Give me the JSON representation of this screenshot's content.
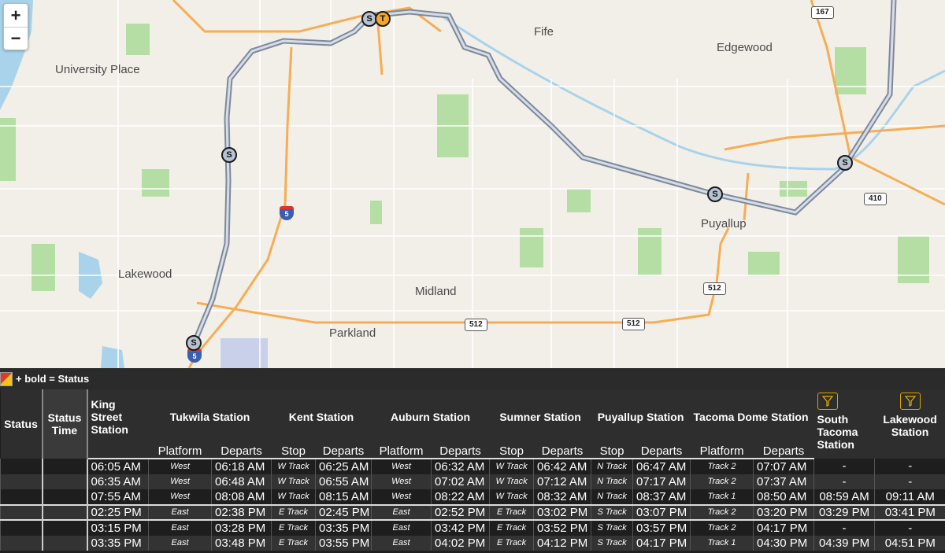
{
  "map": {
    "zoom_in": "+",
    "zoom_out": "−",
    "places": [
      "University Place",
      "Fife",
      "Edgewood",
      "Lakewood",
      "Puyallup",
      "Midland",
      "Parkland"
    ],
    "shields": {
      "sr167": "167",
      "sr410": "410",
      "sr512_a": "512",
      "sr512_b": "512",
      "sr512_c": "512",
      "i5_a": "5",
      "i5_b": "5"
    },
    "stations": [
      "S",
      "T",
      "S",
      "S",
      "S",
      "S"
    ],
    "colors": {
      "rail": "#9aa6b8",
      "highway": "#f6ad55",
      "water": "#a9d3ea",
      "park": "#b5dea5"
    }
  },
  "legend": {
    "text": "+ bold = Status"
  },
  "table": {
    "headers": {
      "status": "Status",
      "status_time": "Status Time",
      "king": "King Street Station",
      "tukwila": "Tukwila Station",
      "kent": "Kent Station",
      "auburn": "Auburn Station",
      "sumner": "Sumner Station",
      "puyallup": "Puyallup Station",
      "tacoma": "Tacoma Dome Station",
      "south_tacoma": "South Tacoma Station",
      "lakewood": "Lakewood Station"
    },
    "subheaders": {
      "platform": "Platform",
      "departs": "Departs",
      "stop": "Stop"
    },
    "rows": [
      [
        "06:05 AM",
        "West",
        "06:18 AM",
        "W Track",
        "06:25 AM",
        "West",
        "06:32 AM",
        "W Track",
        "06:42 AM",
        "N Track",
        "06:47 AM",
        "Track 2",
        "07:07 AM",
        "-",
        "-"
      ],
      [
        "06:35 AM",
        "West",
        "06:48 AM",
        "W Track",
        "06:55 AM",
        "West",
        "07:02 AM",
        "W Track",
        "07:12 AM",
        "N Track",
        "07:17 AM",
        "Track 2",
        "07:37 AM",
        "-",
        "-"
      ],
      [
        "07:55 AM",
        "West",
        "08:08 AM",
        "W Track",
        "08:15 AM",
        "West",
        "08:22 AM",
        "W Track",
        "08:32 AM",
        "N Track",
        "08:37 AM",
        "Track 1",
        "08:50 AM",
        "08:59 AM",
        "09:11 AM"
      ],
      [
        "02:25 PM",
        "East",
        "02:38 PM",
        "E Track",
        "02:45 PM",
        "East",
        "02:52 PM",
        "E Track",
        "03:02 PM",
        "S Track",
        "03:07 PM",
        "Track 2",
        "03:20 PM",
        "03:29 PM",
        "03:41 PM"
      ],
      [
        "03:15 PM",
        "East",
        "03:28 PM",
        "E Track",
        "03:35 PM",
        "East",
        "03:42 PM",
        "E Track",
        "03:52 PM",
        "S Track",
        "03:57 PM",
        "Track 2",
        "04:17 PM",
        "-",
        "-"
      ],
      [
        "03:35 PM",
        "East",
        "03:48 PM",
        "E Track",
        "03:55 PM",
        "East",
        "04:02 PM",
        "E Track",
        "04:12 PM",
        "S Track",
        "04:17 PM",
        "Track 1",
        "04:30 PM",
        "04:39 PM",
        "04:51 PM"
      ]
    ]
  }
}
